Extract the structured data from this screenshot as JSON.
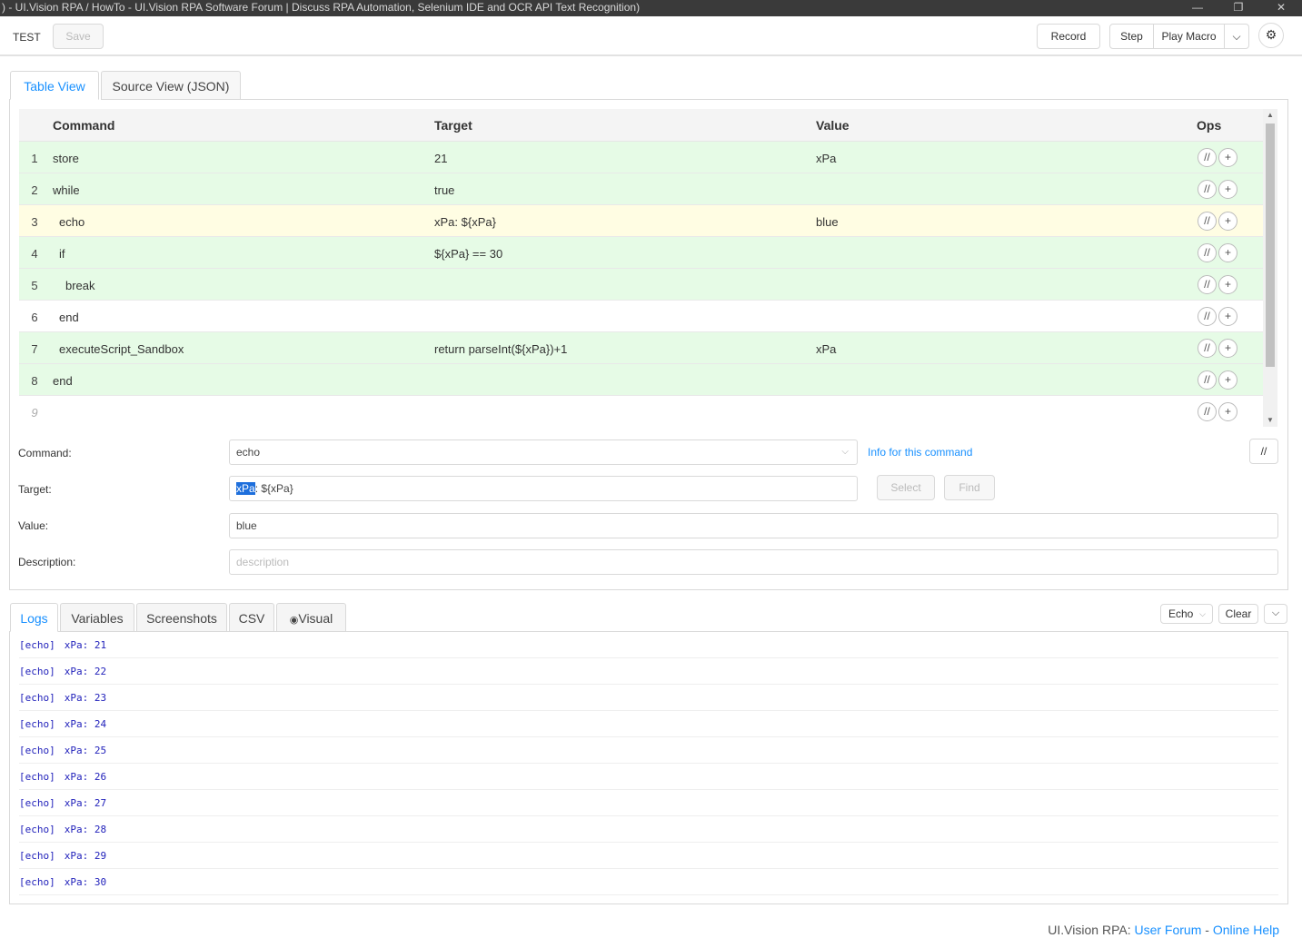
{
  "window": {
    "title": ") - UI.Vision RPA / HowTo - UI.Vision RPA Software Forum | Discuss RPA Automation, Selenium IDE and OCR API Text Recognition)",
    "minimize": "—",
    "restore": "❐",
    "close": "✕"
  },
  "toolbar": {
    "macro_name": "TEST",
    "save_label": "Save",
    "record_label": "Record",
    "step_label": "Step",
    "play_label": "Play Macro",
    "dropdown_icon": "⌵",
    "settings_icon": "⚙"
  },
  "editor_tabs": [
    "Table View",
    "Source View (JSON)"
  ],
  "grid": {
    "headers": {
      "command": "Command",
      "target": "Target",
      "value": "Value",
      "ops": "Ops"
    },
    "rows": [
      {
        "num": "1",
        "command": "store",
        "indent": 0,
        "target": "21",
        "value": "xPa",
        "bg": "green"
      },
      {
        "num": "2",
        "command": "while",
        "indent": 0,
        "target": "true",
        "value": "",
        "bg": "green"
      },
      {
        "num": "3",
        "command": "echo",
        "indent": 1,
        "target": "xPa: ${xPa}",
        "value": "blue",
        "bg": "yellow"
      },
      {
        "num": "4",
        "command": "if",
        "indent": 1,
        "target": "${xPa} == 30",
        "value": "",
        "bg": "green"
      },
      {
        "num": "5",
        "command": "break",
        "indent": 2,
        "target": "",
        "value": "",
        "bg": "green"
      },
      {
        "num": "6",
        "command": "end",
        "indent": 1,
        "target": "",
        "value": "",
        "bg": "white"
      },
      {
        "num": "7",
        "command": "executeScript_Sandbox",
        "indent": 1,
        "target": "return parseInt(${xPa})+1",
        "value": "xPa",
        "bg": "green"
      },
      {
        "num": "8",
        "command": "end",
        "indent": 0,
        "target": "",
        "value": "",
        "bg": "green"
      },
      {
        "num": "9",
        "command": "",
        "indent": 0,
        "target": "",
        "value": "",
        "bg": "empty"
      }
    ],
    "op_comment": "//",
    "op_add": "+"
  },
  "form": {
    "command_label": "Command:",
    "command_value": "echo",
    "info_link": "Info for this command",
    "comment_button": "//",
    "target_label": "Target:",
    "target_selected": "xPa",
    "target_rest": ": ${xPa}",
    "select_label": "Select",
    "find_label": "Find",
    "value_label": "Value:",
    "value_value": "blue",
    "description_label": "Description:",
    "description_placeholder": "description"
  },
  "log_tabs": [
    "Logs",
    "Variables",
    "Screenshots",
    "CSV",
    "Visual"
  ],
  "log_controls": {
    "filter": "Echo",
    "clear": "Clear",
    "collapse": "⌵"
  },
  "logs": [
    {
      "tag": "[echo]",
      "text": "xPa: 21"
    },
    {
      "tag": "[echo]",
      "text": "xPa: 22"
    },
    {
      "tag": "[echo]",
      "text": "xPa: 23"
    },
    {
      "tag": "[echo]",
      "text": "xPa: 24"
    },
    {
      "tag": "[echo]",
      "text": "xPa: 25"
    },
    {
      "tag": "[echo]",
      "text": "xPa: 26"
    },
    {
      "tag": "[echo]",
      "text": "xPa: 27"
    },
    {
      "tag": "[echo]",
      "text": "xPa: 28"
    },
    {
      "tag": "[echo]",
      "text": "xPa: 29"
    },
    {
      "tag": "[echo]",
      "text": "xPa: 30"
    }
  ],
  "footer": {
    "brand": "UI.Vision RPA: ",
    "forum": "User Forum",
    "sep": " - ",
    "help": "Online Help"
  },
  "colors": {
    "accent": "#1890ff",
    "row_green": "#e6fbe6",
    "row_yellow": "#fffde3",
    "log_text": "#2222bb"
  }
}
